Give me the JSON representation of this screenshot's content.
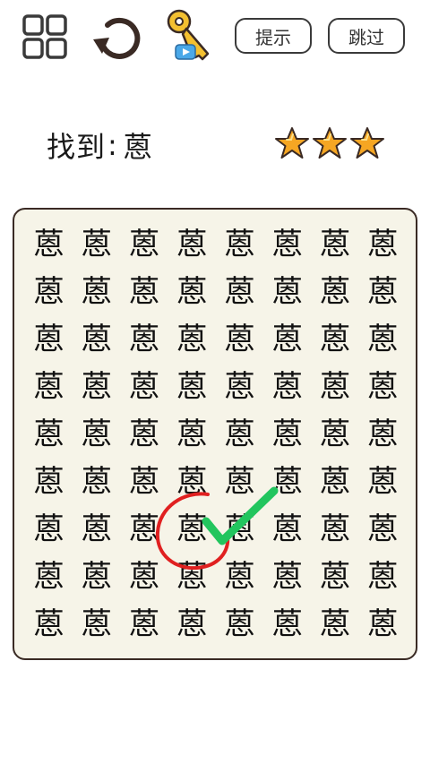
{
  "toolbar": {
    "menu_icon": "grid-menu-icon",
    "restart_icon": "restart-icon",
    "key_icon": "key-video-icon",
    "hint_label": "提示",
    "skip_label": "跳过"
  },
  "task": {
    "prefix": "找到",
    "separator": ":",
    "character": "蒽"
  },
  "rating": {
    "stars": 3,
    "star_color": "#f5a623"
  },
  "board": {
    "rows": 9,
    "cols": 8,
    "grid": [
      [
        "蒽",
        "蒽",
        "蒽",
        "蒽",
        "蒽",
        "蒽",
        "蒽",
        "蒽"
      ],
      [
        "蒽",
        "蒽",
        "蒽",
        "蒽",
        "蒽",
        "蒽",
        "蒽",
        "蒽"
      ],
      [
        "蒽",
        "蒽",
        "蒽",
        "蒽",
        "蒽",
        "蒽",
        "蒽",
        "蒽"
      ],
      [
        "蒽",
        "蒽",
        "蒽",
        "蒽",
        "蒽",
        "蒽",
        "蒽",
        "蒽"
      ],
      [
        "蒽",
        "蒽",
        "蒽",
        "蒽",
        "蒽",
        "蒽",
        "蒽",
        "蒽"
      ],
      [
        "蒽",
        "蒽",
        "蒽",
        "蒽",
        "蒽",
        "蒽",
        "蒽",
        "蒽"
      ],
      [
        "蒽",
        "蒽",
        "蒽",
        "蒽",
        "蒽",
        "蒽",
        "蒽",
        "蒽"
      ],
      [
        "蒽",
        "蒽",
        "蒽",
        "蒽",
        "蒽",
        "蒽",
        "蒽",
        "蒽"
      ],
      [
        "蒽",
        "蒽",
        "蒽",
        "蒽",
        "蒽",
        "蒽",
        "蒽",
        "蒽"
      ]
    ],
    "found_cell": {
      "row": 6,
      "col": 3
    },
    "circle_color": "#e02020",
    "check_color": "#22c55e"
  }
}
